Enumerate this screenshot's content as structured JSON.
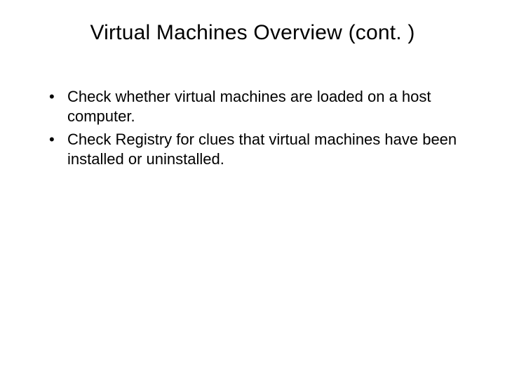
{
  "slide": {
    "title": "Virtual Machines Overview (cont. )",
    "bullets": [
      "Check whether virtual machines are loaded on a host computer.",
      "Check Registry for clues that virtual machines have been installed or uninstalled."
    ]
  }
}
